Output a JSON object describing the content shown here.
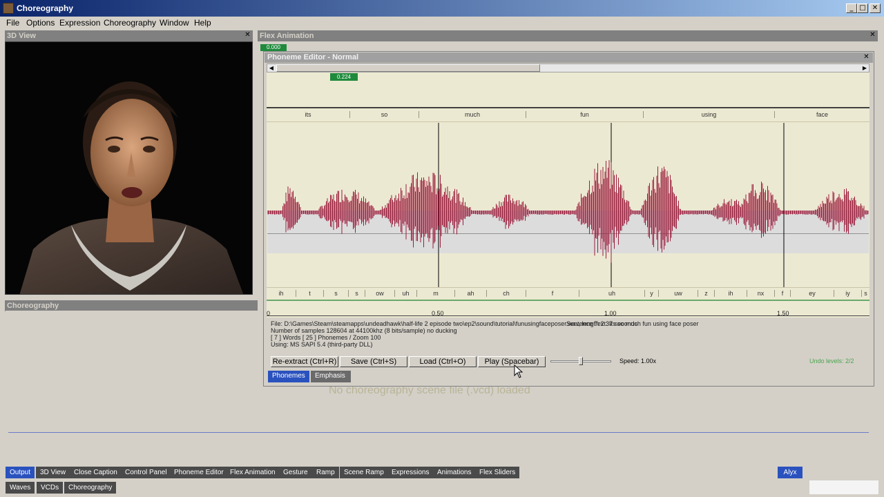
{
  "app": {
    "title": "Choreography",
    "minimize": "_",
    "maximize": "□",
    "close": "✕"
  },
  "menu": [
    "File",
    "Options",
    "Expression",
    "Choreography",
    "Window",
    "Help"
  ],
  "view3d": {
    "title": "3D View",
    "close": "✕"
  },
  "choreography": {
    "title": "Choreography",
    "message": "No choreography scene file (.vcd) loaded"
  },
  "flex": {
    "title": "Flex Animation",
    "close": "✕",
    "time_badge": "0.000"
  },
  "phoneme_editor": {
    "title": "Phoneme Editor - Normal",
    "close": "✕",
    "time_badge": "0.224",
    "words": [
      "its",
      "so",
      "much",
      "fun",
      "using",
      "face"
    ],
    "phonemes": [
      "ih",
      "t",
      "s",
      "s",
      "ow",
      "uh",
      "m",
      "ah",
      "ch",
      "f",
      "uh",
      "y",
      "uw",
      "z",
      "ih",
      "nx",
      "f",
      "ey",
      "iy",
      "s"
    ],
    "ruler_labels": [
      "0",
      "0.50",
      "1.00",
      "1.50"
    ],
    "info": {
      "file_line": "File: D:\\Games\\Steam\\steamapps\\undeadhawk\\half-life 2 episode two\\ep2\\sound\\tutorial\\funusingfaceposer.wav, length 2.37 seconds",
      "sentence": "Sentence Text: Its so much fun using face poser",
      "samples": "Number of samples 128604 at 44100khz (8 bits/sample) no ducking",
      "words": "[ 7 ] Words [ 25 ] Phonemes / Zoom 100",
      "using": "Using:  MS SAPI 5.4 (third-party DLL)"
    },
    "buttons": {
      "reextract": "Re-extract (Ctrl+R)",
      "save": "Save (Ctrl+S)",
      "load": "Load (Ctrl+O)",
      "play": "Play (Spacebar)"
    },
    "speed": "Speed: 1.00x",
    "undo": "Undo levels: 2/2",
    "tabs": [
      "Phonemes",
      "Emphasis"
    ]
  },
  "bottom_tabs_row1": [
    "Output",
    "3D View",
    "Close Caption",
    "Control Panel",
    "Phoneme Editor",
    "Flex Animation",
    "Gesture",
    "Ramp",
    "Scene Ramp",
    "Expressions",
    "Animations",
    "Flex Sliders"
  ],
  "bottom_tabs_row2": [
    "Waves",
    "VCDs",
    "Choreography"
  ],
  "actor_tab": "Alyx",
  "colors": {
    "titlebar_start": "#0a246a",
    "wave": "#9b1c3c",
    "badge": "#1f8a3c",
    "active_tab": "#2a52be"
  }
}
